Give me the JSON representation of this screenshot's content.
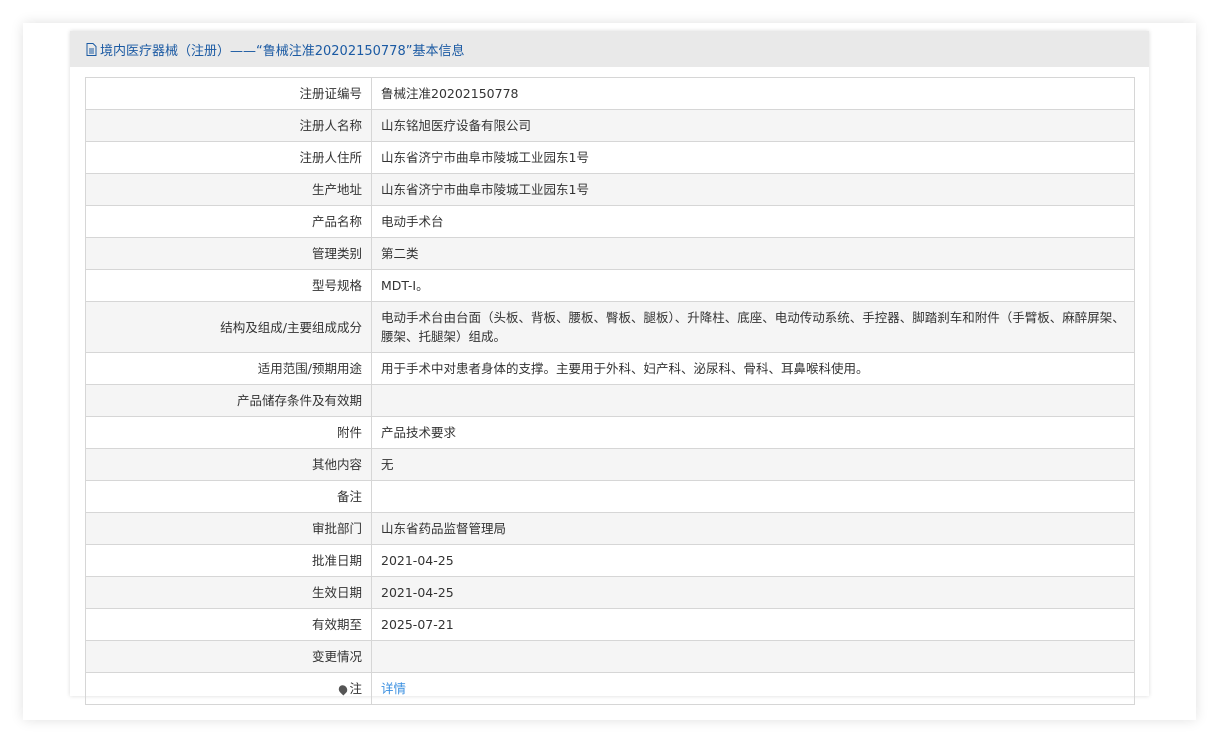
{
  "title": "境内医疗器械（注册）——“鲁械注准20202150778”基本信息",
  "rows": [
    {
      "label": "注册证编号",
      "value": "鲁械注准20202150778"
    },
    {
      "label": "注册人名称",
      "value": "山东铭旭医疗设备有限公司"
    },
    {
      "label": "注册人住所",
      "value": "山东省济宁市曲阜市陵城工业园东1号"
    },
    {
      "label": "生产地址",
      "value": "山东省济宁市曲阜市陵城工业园东1号"
    },
    {
      "label": "产品名称",
      "value": "电动手术台"
    },
    {
      "label": "管理类别",
      "value": "第二类"
    },
    {
      "label": "型号规格",
      "value": "MDT-I。"
    },
    {
      "label": "结构及组成/主要组成成分",
      "value": "电动手术台由台面（头板、背板、腰板、臀板、腿板）、升降柱、底座、电动传动系统、手控器、脚踏刹车和附件（手臂板、麻醉屏架、腰架、托腿架）组成。"
    },
    {
      "label": "适用范围/预期用途",
      "value": "用于手术中对患者身体的支撑。主要用于外科、妇产科、泌尿科、骨科、耳鼻喉科使用。"
    },
    {
      "label": "产品储存条件及有效期",
      "value": ""
    },
    {
      "label": "附件",
      "value": "产品技术要求"
    },
    {
      "label": "其他内容",
      "value": "无"
    },
    {
      "label": "备注",
      "value": ""
    },
    {
      "label": "审批部门",
      "value": "山东省药品监督管理局"
    },
    {
      "label": "批准日期",
      "value": "2021-04-25"
    },
    {
      "label": "生效日期",
      "value": "2021-04-25"
    },
    {
      "label": "有效期至",
      "value": "2025-07-21"
    },
    {
      "label": "变更情况",
      "value": ""
    }
  ],
  "note": {
    "label": "注",
    "link": "详情"
  }
}
